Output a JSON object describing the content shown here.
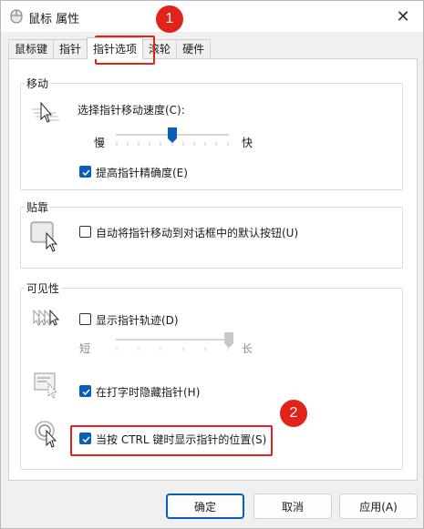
{
  "window": {
    "title": "鼠标 属性",
    "close_glyph": "✕"
  },
  "tabs": [
    {
      "label": "鼠标键",
      "active": false
    },
    {
      "label": "指针",
      "active": false
    },
    {
      "label": "指针选项",
      "active": true
    },
    {
      "label": "滚轮",
      "active": false
    },
    {
      "label": "硬件",
      "active": false
    }
  ],
  "motion": {
    "group_label": "移动",
    "speed_label": "选择指针移动速度(C):",
    "slow_label": "慢",
    "fast_label": "快",
    "speed_level": 0.5,
    "precision_label": "提高指针精确度(E)",
    "precision_checked": true
  },
  "snap": {
    "group_label": "贴靠",
    "snap_label": "自动将指针移动到对话框中的默认按钮(U)",
    "snap_checked": false
  },
  "visibility": {
    "group_label": "可见性",
    "trails_label": "显示指针轨迹(D)",
    "trails_checked": false,
    "short_label": "短",
    "long_label": "长",
    "trail_level": 1.0,
    "hide_typing_label": "在打字时隐藏指针(H)",
    "hide_typing_checked": true,
    "ctrl_label": "当按 CTRL 键时显示指针的位置(S)",
    "ctrl_checked": true
  },
  "buttons": {
    "ok": "确定",
    "cancel": "取消",
    "apply": "应用(A)"
  },
  "annotations": {
    "badge1": "1",
    "badge2": "2",
    "color": "#e3231b"
  },
  "accent_color": "#0a5fb4"
}
